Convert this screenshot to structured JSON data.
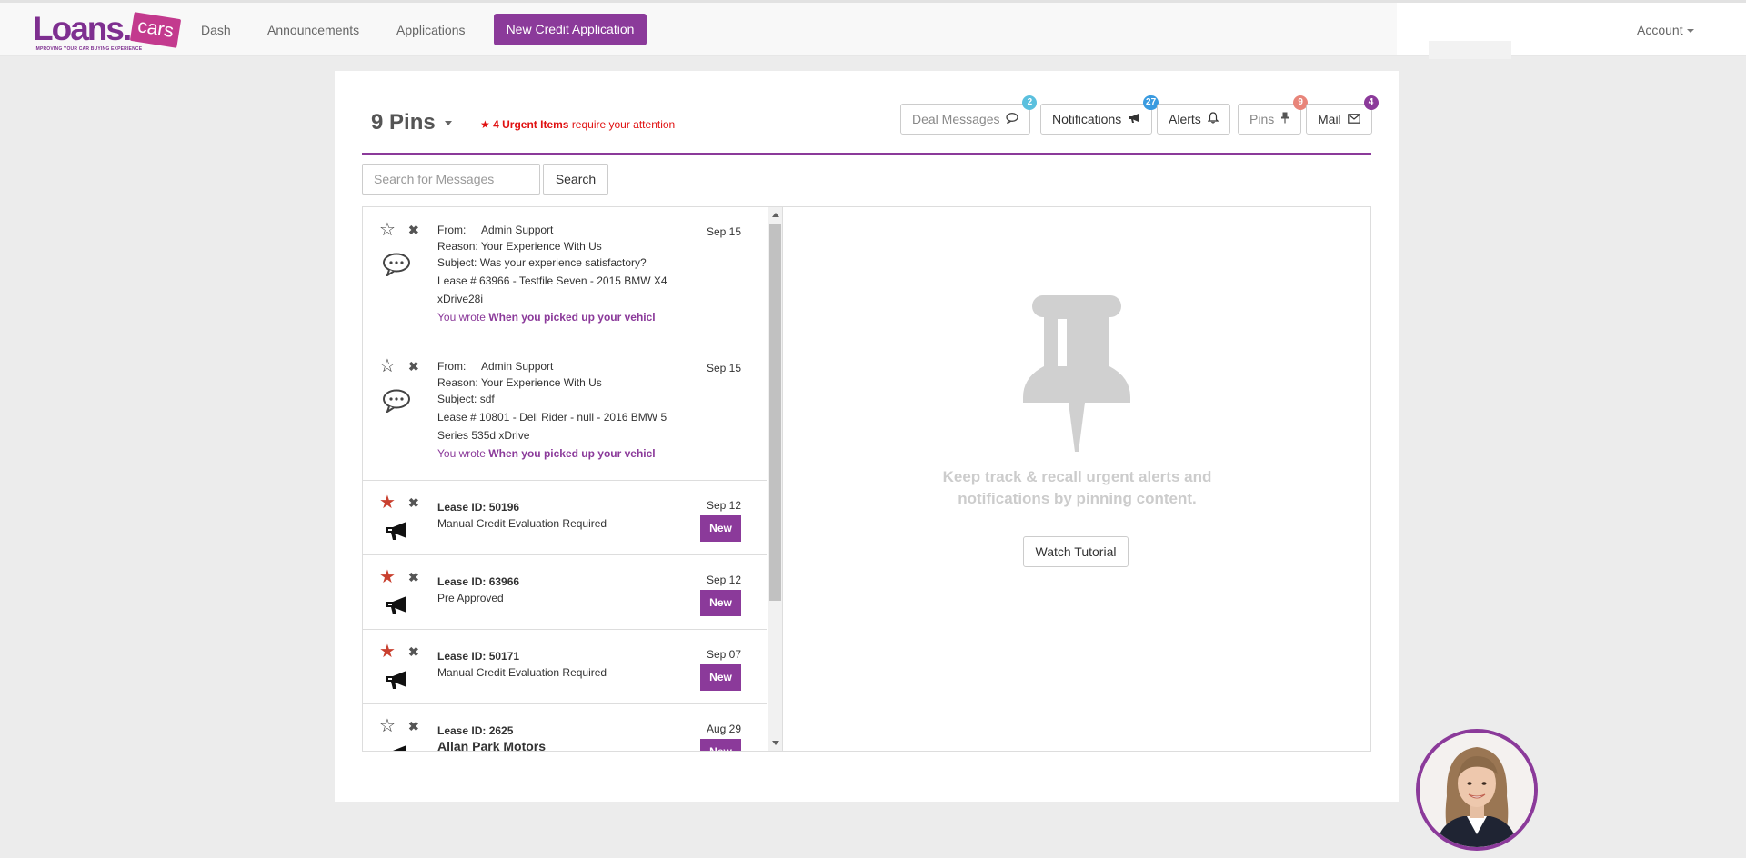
{
  "nav": {
    "logo": {
      "main": "Loans.",
      "accent": "cars",
      "tagline": "IMPROVING YOUR CAR BUYING EXPERIENCE"
    },
    "links": [
      "Dash",
      "Announcements",
      "Applications"
    ],
    "cta": "New Credit Application",
    "account": "Account"
  },
  "header": {
    "pins_title": "9 Pins",
    "urgent_count": "4 Urgent Items",
    "urgent_text": "require your attention",
    "buttons": [
      {
        "label": "Deal Messages",
        "icon": "comment-icon",
        "badge": "2",
        "badge_color": "#5bc0de"
      },
      {
        "label": "Notifications",
        "icon": "bullhorn-icon",
        "badge": "27",
        "badge_color": "#3a9be0"
      },
      {
        "label": "Alerts",
        "icon": "bell-icon",
        "badge": ""
      },
      {
        "label": "Pins",
        "icon": "pin-icon",
        "badge": "9",
        "badge_color": "#e8857a"
      },
      {
        "label": "Mail",
        "icon": "envelope-icon",
        "badge": "4",
        "badge_color": "#8b3a9a"
      }
    ]
  },
  "search": {
    "placeholder": "Search for Messages",
    "button": "Search"
  },
  "messages": [
    {
      "from_label": "From:",
      "from": "Admin Support",
      "reason_label": "Reason:",
      "reason": "Your Experience With Us",
      "subject_label": "Subject:",
      "subject": "Was your experience satisfactory?",
      "lease_line1": "Lease # 63966 - Testfile Seven - 2015 BMW X4",
      "lease_line2": "xDrive28i",
      "wrote_label": "You wrote",
      "wrote": "When you picked up your vehicl",
      "date": "Sep 15",
      "starred": false
    },
    {
      "from_label": "From:",
      "from": "Admin Support",
      "reason_label": "Reason:",
      "reason": "Your Experience With Us",
      "subject_label": "Subject:",
      "subject": "sdf",
      "lease_line1": "Lease # 10801 - Dell Rider - null - 2016 BMW 5",
      "lease_line2": "Series 535d xDrive",
      "wrote_label": "You wrote",
      "wrote": "When you picked up your vehicl",
      "date": "Sep 15",
      "starred": false
    }
  ],
  "notifications": [
    {
      "lease": "Lease ID: 50196",
      "text": "Manual Credit Evaluation Required",
      "date": "Sep 12",
      "badge": "New",
      "starred": true
    },
    {
      "lease": "Lease ID: 63966",
      "text": "Pre Approved",
      "date": "Sep 12",
      "badge": "New",
      "starred": true
    },
    {
      "lease": "Lease ID: 50171",
      "text": "Manual Credit Evaluation Required",
      "date": "Sep 07",
      "badge": "New",
      "starred": true
    },
    {
      "lease": "Lease ID: 2625",
      "text": "Allan Park Motors",
      "date": "Aug 29",
      "badge": "New",
      "starred": false
    }
  ],
  "empty_state": {
    "line1": "Keep track & recall urgent alerts and",
    "line2": "notifications by pinning content.",
    "button": "Watch Tutorial"
  },
  "colors": {
    "brand": "#8b3a9a",
    "urgent": "#e01010",
    "star_on": "#c9402f"
  }
}
